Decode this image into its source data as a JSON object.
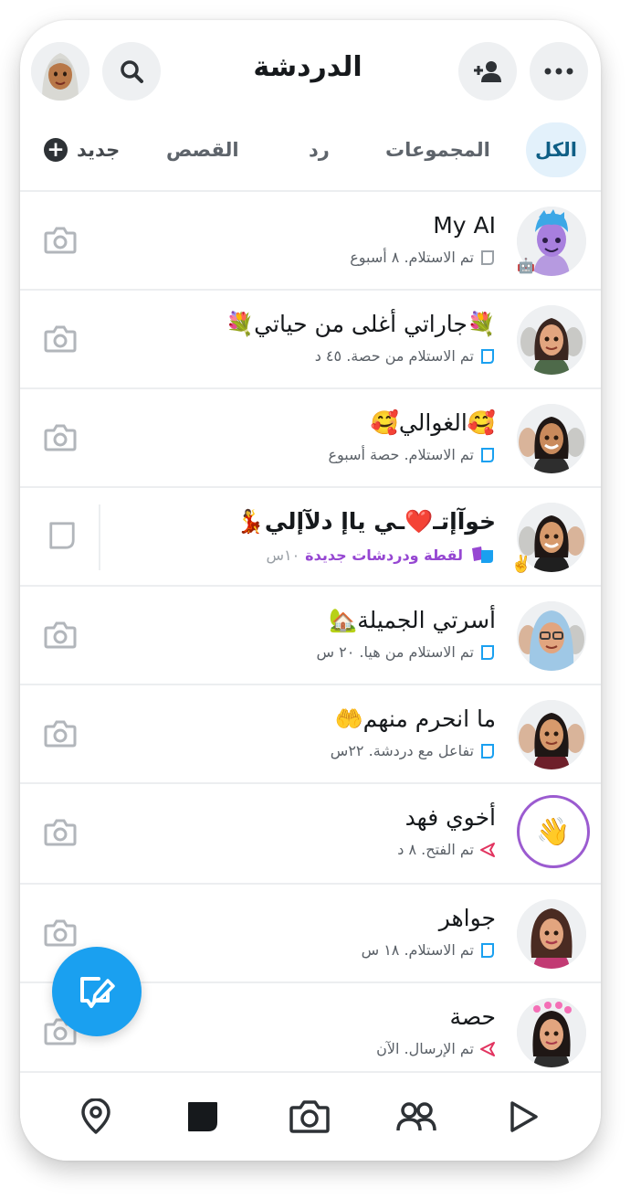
{
  "header": {
    "title": "الدردشة",
    "profile_icon": "bitmoji-avatar",
    "search_icon": "search-icon",
    "add_friend_icon": "add-friend-icon",
    "more_icon": "more-icon"
  },
  "tabs": [
    {
      "label": "الكل",
      "active": true
    },
    {
      "label": "المجموعات",
      "active": false
    },
    {
      "label": "رد",
      "active": false
    },
    {
      "label": "القصص",
      "active": false
    },
    {
      "label": "جديد",
      "active": false
    }
  ],
  "chats": [
    {
      "name": "My AI",
      "status": "تم الاستلام. ٨ أسبوع",
      "status_icon": "chat-outline-icon",
      "action_icon": "camera-icon"
    },
    {
      "name": "💐جاراتي أغلى من حياتي💐",
      "status": "تم الاستلام من حصة. ٤٥ د",
      "status_icon": "chat-blue-outline-icon",
      "action_icon": "camera-icon"
    },
    {
      "name": "🥰الغوالي🥰",
      "status": "تم الاستلام. حصة أسبوع",
      "status_icon": "chat-blue-outline-icon",
      "action_icon": "camera-icon"
    },
    {
      "name": "خوآإتـ❤️ـي ياإ دلآإلي💃",
      "status": "لقطة ودردشات جديدة",
      "time": "١٠س",
      "status_icon": "snap-chat-new-icon",
      "action_icon": "chat-icon",
      "badge": "✌️"
    },
    {
      "name": "أسرتي الجميلة🏡",
      "status": "تم الاستلام من هيا. ٢٠ س",
      "status_icon": "chat-blue-outline-icon",
      "action_icon": "camera-icon"
    },
    {
      "name": "ما انحرم منهم🤲",
      "status": "تفاعل مع دردشة. ٢٢س",
      "status_icon": "chat-blue-outline-icon",
      "action_icon": "camera-icon"
    },
    {
      "name": "أخوي فهد",
      "status": "تم الفتح. ٨ د",
      "status_icon": "sent-arrow-icon",
      "action_icon": "camera-icon",
      "avatar_emoji": "👋"
    },
    {
      "name": "جواهر",
      "status": "تم الاستلام. ١٨ س",
      "status_icon": "chat-blue-outline-icon",
      "action_icon": "camera-icon"
    },
    {
      "name": "حصة",
      "status": "تم الإرسال. الآن",
      "status_icon": "sent-arrow-icon",
      "action_icon": "camera-icon"
    }
  ],
  "fab_icon": "new-chat-icon",
  "bottom_nav": [
    "map-icon",
    "chat-icon",
    "camera-icon",
    "friends-icon",
    "spotlight-play-icon"
  ],
  "colors": {
    "accent": "#1aa0f0",
    "tab_active_bg": "#e3f1fb",
    "new_snap": "#9647d2",
    "sent_red": "#e2335f"
  }
}
